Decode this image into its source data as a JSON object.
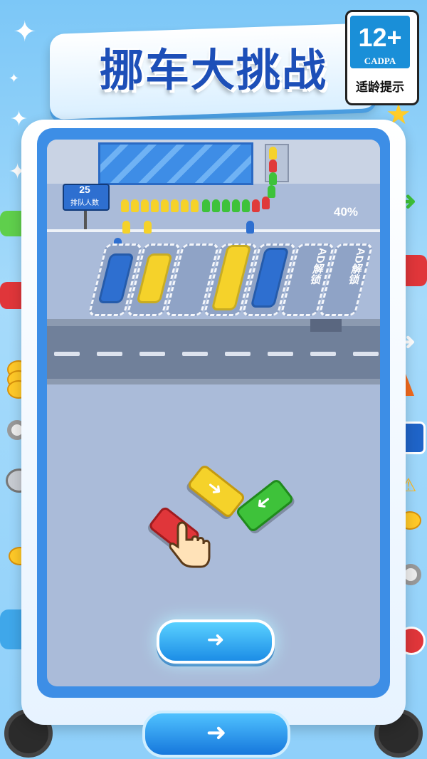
{
  "title": "挪车大挑战",
  "age_rating": {
    "number": "12+",
    "org": "CADPA",
    "tip": "适龄提示"
  },
  "board": {
    "queue_sign": {
      "count": "25",
      "label": "排队人数"
    },
    "progress_percent": "40%",
    "ad_slots": [
      {
        "label": "AD解锁"
      },
      {
        "label": "AD解锁"
      }
    ]
  },
  "buttons": {
    "next_icon": "➜",
    "bottom_icon": "➜"
  },
  "colors": {
    "accent": "#1d4fb8",
    "board": "#aabbd9",
    "frame": "#3d8ee6"
  }
}
